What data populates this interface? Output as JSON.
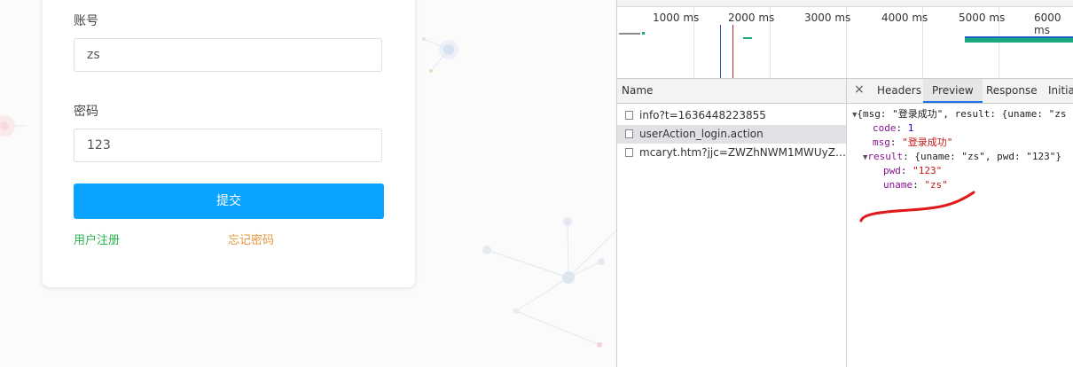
{
  "login": {
    "account_label": "账号",
    "account_value": "zs",
    "password_label": "密码",
    "password_value": "123",
    "submit_label": "提交",
    "register_link": "用户注册",
    "forgot_link": "忘记密码"
  },
  "devtools": {
    "timeline_ticks": [
      "1000 ms",
      "2000 ms",
      "3000 ms",
      "4000 ms",
      "5000 ms",
      "6000 ms"
    ],
    "name_header": "Name",
    "requests": [
      {
        "name": "info?t=1636448223855",
        "selected": false
      },
      {
        "name": "userAction_login.action",
        "selected": true
      },
      {
        "name": "mcaryt.htm?jjc=ZWZhNWM1MWUyZGN...",
        "selected": false
      }
    ],
    "close_glyph": "×",
    "tabs": [
      "Headers",
      "Preview",
      "Response",
      "Initiat"
    ],
    "active_tab": "Preview",
    "preview": {
      "root_summary": "{msg: \"登录成功\", result: {uname: \"zs",
      "code_key": "code",
      "code_value": "1",
      "msg_key": "msg",
      "msg_value": "\"登录成功\"",
      "result_key": "result",
      "result_summary": "{uname: \"zs\", pwd: \"123\"}",
      "pwd_key": "pwd",
      "pwd_value": "\"123\"",
      "uname_key": "uname",
      "uname_value": "\"zs\""
    }
  },
  "colors": {
    "submit_bg": "#0aa3ff",
    "register_link": "#29b34a",
    "forgot_link": "#e6963c",
    "json_key": "#881391",
    "json_string": "#c41a16",
    "json_number": "#1c00cf",
    "annotation_stroke": "#e0191b"
  }
}
